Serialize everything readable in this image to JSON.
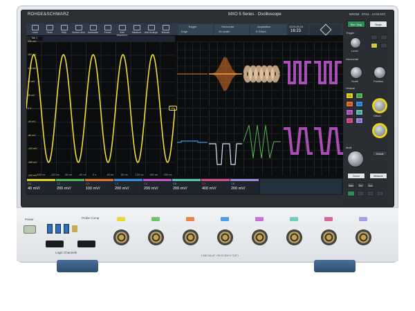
{
  "header": {
    "brand": "ROHDE&SCHWARZ",
    "model": "MXO 5 Series · Oscilloscope",
    "model_short": "MXO58 · 2GHz · 12-bit ADC"
  },
  "toolbar": {
    "buttons": [
      "Undo",
      "Redo",
      "Help",
      "Screen-shot",
      "Autoscale",
      "Preset",
      "Add Waveform",
      "Measure",
      "Add Arrange",
      "Bitcode"
    ]
  },
  "tab": {
    "label": "Tab 1"
  },
  "top_info": {
    "trigger": "Trigger",
    "horizontal": "Horizontal",
    "acquisition": "Acquisition",
    "trigger_value": "Edge",
    "horizontal_value": "40 ns/div",
    "acq_value": "5 GSa/s",
    "date": "2023-05-24",
    "time": "16:23"
  },
  "main_plot": {
    "y_labels": [
      "200 mV",
      "160 mV",
      "120 mV",
      "80 mV",
      "40 mV",
      "0 V",
      "-40 mV",
      "-80 mV",
      "-120 mV",
      "-160 mV",
      "-200 mV"
    ],
    "x_labels": [
      "-160 ns",
      "-120 ns",
      "-80 ns",
      "-40 ns",
      "0 s",
      "40 ns",
      "80 ns",
      "120 ns",
      "160 ns",
      "200 ns"
    ],
    "marker": "C1"
  },
  "channels": [
    {
      "name": "C1",
      "value": "40 mV/",
      "color": "#e5d21a"
    },
    {
      "name": "C2",
      "value": "200 mV/",
      "color": "#57b957"
    },
    {
      "name": "C3",
      "value": "100 mV/",
      "color": "#e2752a"
    },
    {
      "name": "C4",
      "value": "200 mV/",
      "color": "#3a8ee0"
    },
    {
      "name": "C5",
      "value": "200 mV/",
      "color": "#c35ad0"
    },
    {
      "name": "C6",
      "value": "200 mV/",
      "color": "#5fc4b4"
    },
    {
      "name": "C7",
      "value": "400 mV/",
      "color": "#d74e8c"
    },
    {
      "name": "C8",
      "value": "200 mV/",
      "color": "#9a8fe0"
    }
  ],
  "right_panel": {
    "run_stop": "Run / Stop",
    "single": "Single",
    "trigger": "Trigger",
    "level": "Level",
    "horizontal": "Horizontal",
    "scale": "Scale",
    "position": "Position",
    "vertical": "Vertical",
    "offset": "Offset",
    "multi": "Multi",
    "cursor": "Cursor",
    "measure": "Measure",
    "math": "Math",
    "ref": "Ref",
    "bus": "Bus",
    "default": "Default"
  },
  "front": {
    "power": "Power",
    "probe_comp": "Probe Comp",
    "logic_channels": "Logic Channels",
    "spec": "1 MΩ 16 pF / 50 Ω 300 V CAT I",
    "channel_leds": [
      "#e5d21a",
      "#57b957",
      "#e2752a",
      "#3a8ee0",
      "#c35ad0",
      "#5fc4b4",
      "#d74e8c",
      "#9a8fe0"
    ]
  }
}
